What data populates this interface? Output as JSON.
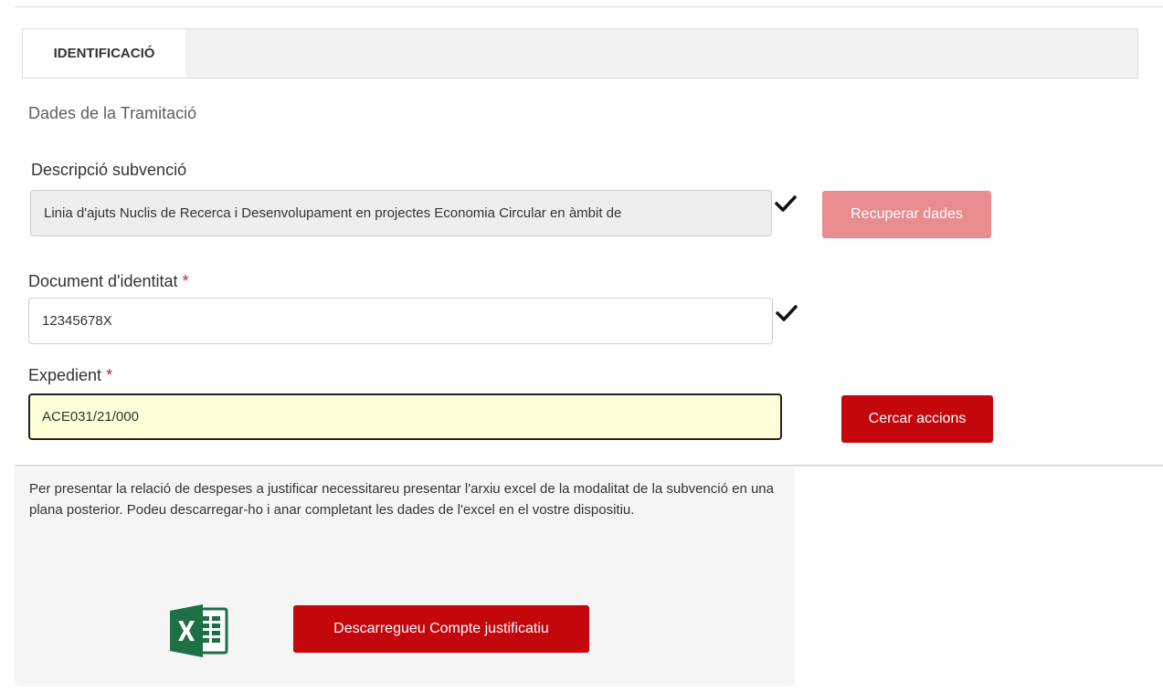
{
  "tabs": {
    "identificacio_label": "IDENTIFICACIÓ"
  },
  "section": {
    "title": "Dades de la Tramitació"
  },
  "descripcio": {
    "label": "Descripció subvenció",
    "value": "Linia d'ajuts Nuclis de Recerca i Desenvolupament en projectes Economia Circular en àmbit de"
  },
  "recuperar_button": {
    "label": "Recuperar dades"
  },
  "document": {
    "label": "Document d'identitat",
    "required_mark": "*",
    "value": "12345678X"
  },
  "expedient": {
    "label": "Expedient",
    "required_mark": "*",
    "value": "ACE031/21/000"
  },
  "cercar_button": {
    "label": "Cercar accions"
  },
  "info": {
    "text": "Per presentar la relació de despeses a justificar necessitareu presentar l'arxiu excel de la modalitat de la subvenció en una plana posterior. Podeu descarregar-ho i anar completant les dades de l'excel en el vostre dispositiu.",
    "icon": "excel-icon",
    "download_label": "Descarregueu Compte justificatiu"
  },
  "colors": {
    "accent_red": "#c4060d",
    "disabled_red": "#e88c8f",
    "excel_green": "#1d7045",
    "focused_field_bg": "#ffffd9"
  }
}
